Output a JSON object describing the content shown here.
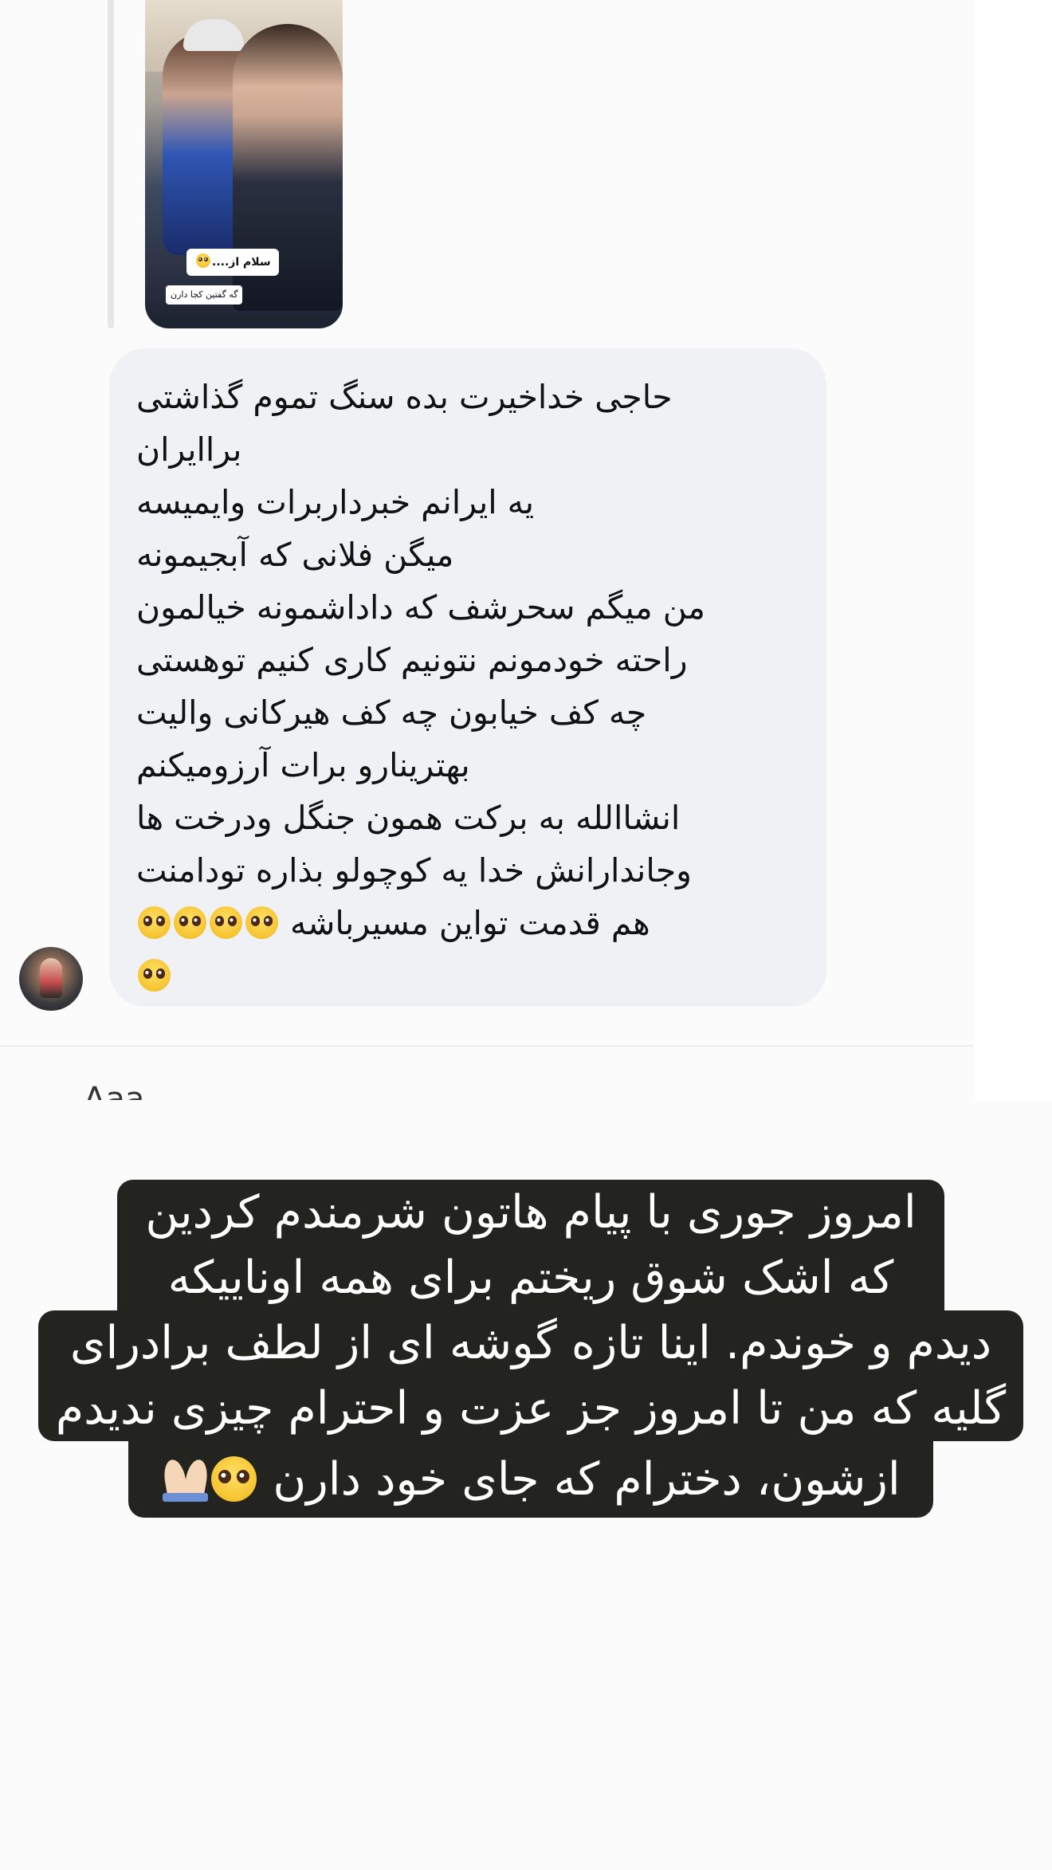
{
  "thread": {
    "story_reply": {
      "sticker_main": "سلام از....",
      "sticker_sub": "گه گفتین کجا دارن"
    },
    "message": {
      "lines": [
        "حاجی خداخیرت بده سنگ تموم گذاشتی",
        "براایران",
        "یه ایرانم خبرداربرات وایمیسه",
        "میگن فلانی که آبجیمونه",
        "من میگم سحرشف که داداشمونه خیالمون",
        "راحته خودمونم نتونیم کاری کنیم توهستی",
        "چه کف خیابون چه کف هیرکانی والیت",
        "بهترینارو برات آرزومیکنم",
        "انشاالله به برکت همون جنگل ودرخت ها",
        "وجاندارانش خدا یه کوچولو بذاره تودامنت",
        "هم قدمت تواین مسیرباشه"
      ],
      "emoji": "pleading-face"
    },
    "next_preview_text": "Aaa"
  },
  "caption": {
    "lines": [
      "امروز جوری با پیام هاتون شرمندم کردین",
      "که اشک شوق ریختم برای همه اوناییکه",
      "دیدم و خوندم. اینا تازه گوشه ای از لطف برادرای",
      "گلیه که من تا امروز جز عزت و احترام چیزی ندیدم",
      "ازشون، دخترام که جای خود دارن"
    ],
    "end_emojis": [
      "pleading-face",
      "folded-hands"
    ],
    "background": "#232320",
    "text_color": "#ffffff"
  },
  "colors": {
    "page_bg": "#fbfbfc",
    "bubble_bg": "#f0f1f4",
    "message_text": "#111111"
  }
}
